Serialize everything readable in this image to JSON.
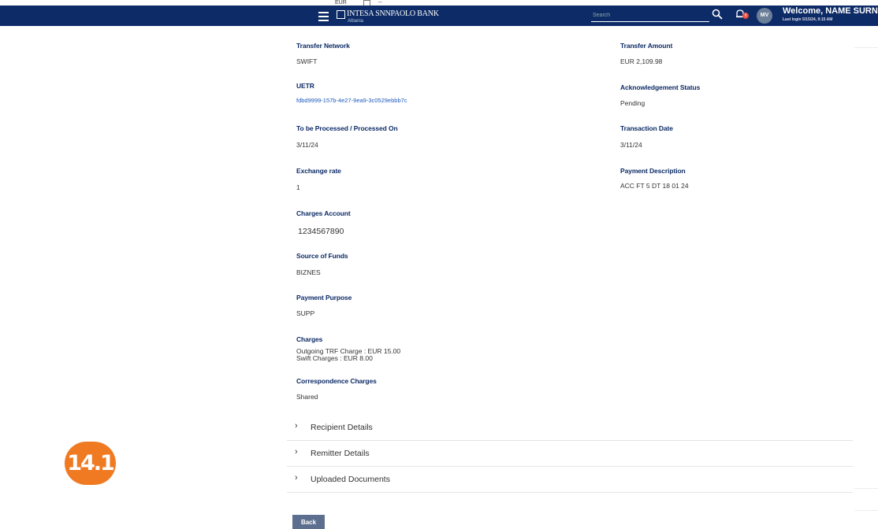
{
  "header": {
    "snippet_currency": "EUR",
    "snippet_dash": "--",
    "bank_name": "INTESA SNNPAOLO BANK",
    "bank_sub": "Albania",
    "search_placeholder": "Search",
    "notification_count": "9",
    "avatar_initials": "MV",
    "welcome": "Welcome, NAME SURN",
    "last_login": "Last login 5/15/24, 9:15 AM"
  },
  "details": {
    "transfer_network": {
      "label": "Transfer Network",
      "value": "SWIFT"
    },
    "uetr": {
      "label": "UETR",
      "value": "fdbd9999-157b-4e27-9ea9-3c0529ebbb7c"
    },
    "processed_on": {
      "label": "To be Processed / Processed On",
      "value": "3/11/24"
    },
    "exchange_rate": {
      "label": "Exchange rate",
      "value": "1"
    },
    "charges_account": {
      "label": "Charges Account",
      "value": "1234567890"
    },
    "source_of_funds": {
      "label": "Source of Funds",
      "value": "BIZNES"
    },
    "payment_purpose": {
      "label": "Payment Purpose",
      "value": "SUPP"
    },
    "charges": {
      "label": "Charges",
      "line1": "Outgoing TRF Charge : EUR 15.00",
      "line2": "Swift Charges : EUR 8.00"
    },
    "correspondence_charges": {
      "label": "Correspondence Charges",
      "value": "Shared"
    },
    "transfer_amount": {
      "label": "Transfer Amount",
      "value": "EUR 2,109.98"
    },
    "ack_status": {
      "label": "Acknowledgement Status",
      "value": "Pending"
    },
    "transaction_date": {
      "label": "Transaction Date",
      "value": "3/11/24"
    },
    "payment_description": {
      "label": "Payment Description",
      "value": "ACC FT 5 DT 18 01 24"
    }
  },
  "accordions": [
    {
      "label": "Recipient Details"
    },
    {
      "label": "Remitter Details"
    },
    {
      "label": "Uploaded Documents"
    }
  ],
  "back_label": "Back",
  "step_badge": "14.1",
  "colors": {
    "header_bg": "#0d2b66",
    "label": "#0d2b66",
    "badge": "#f07a22",
    "back_button": "#5d6f8f"
  }
}
